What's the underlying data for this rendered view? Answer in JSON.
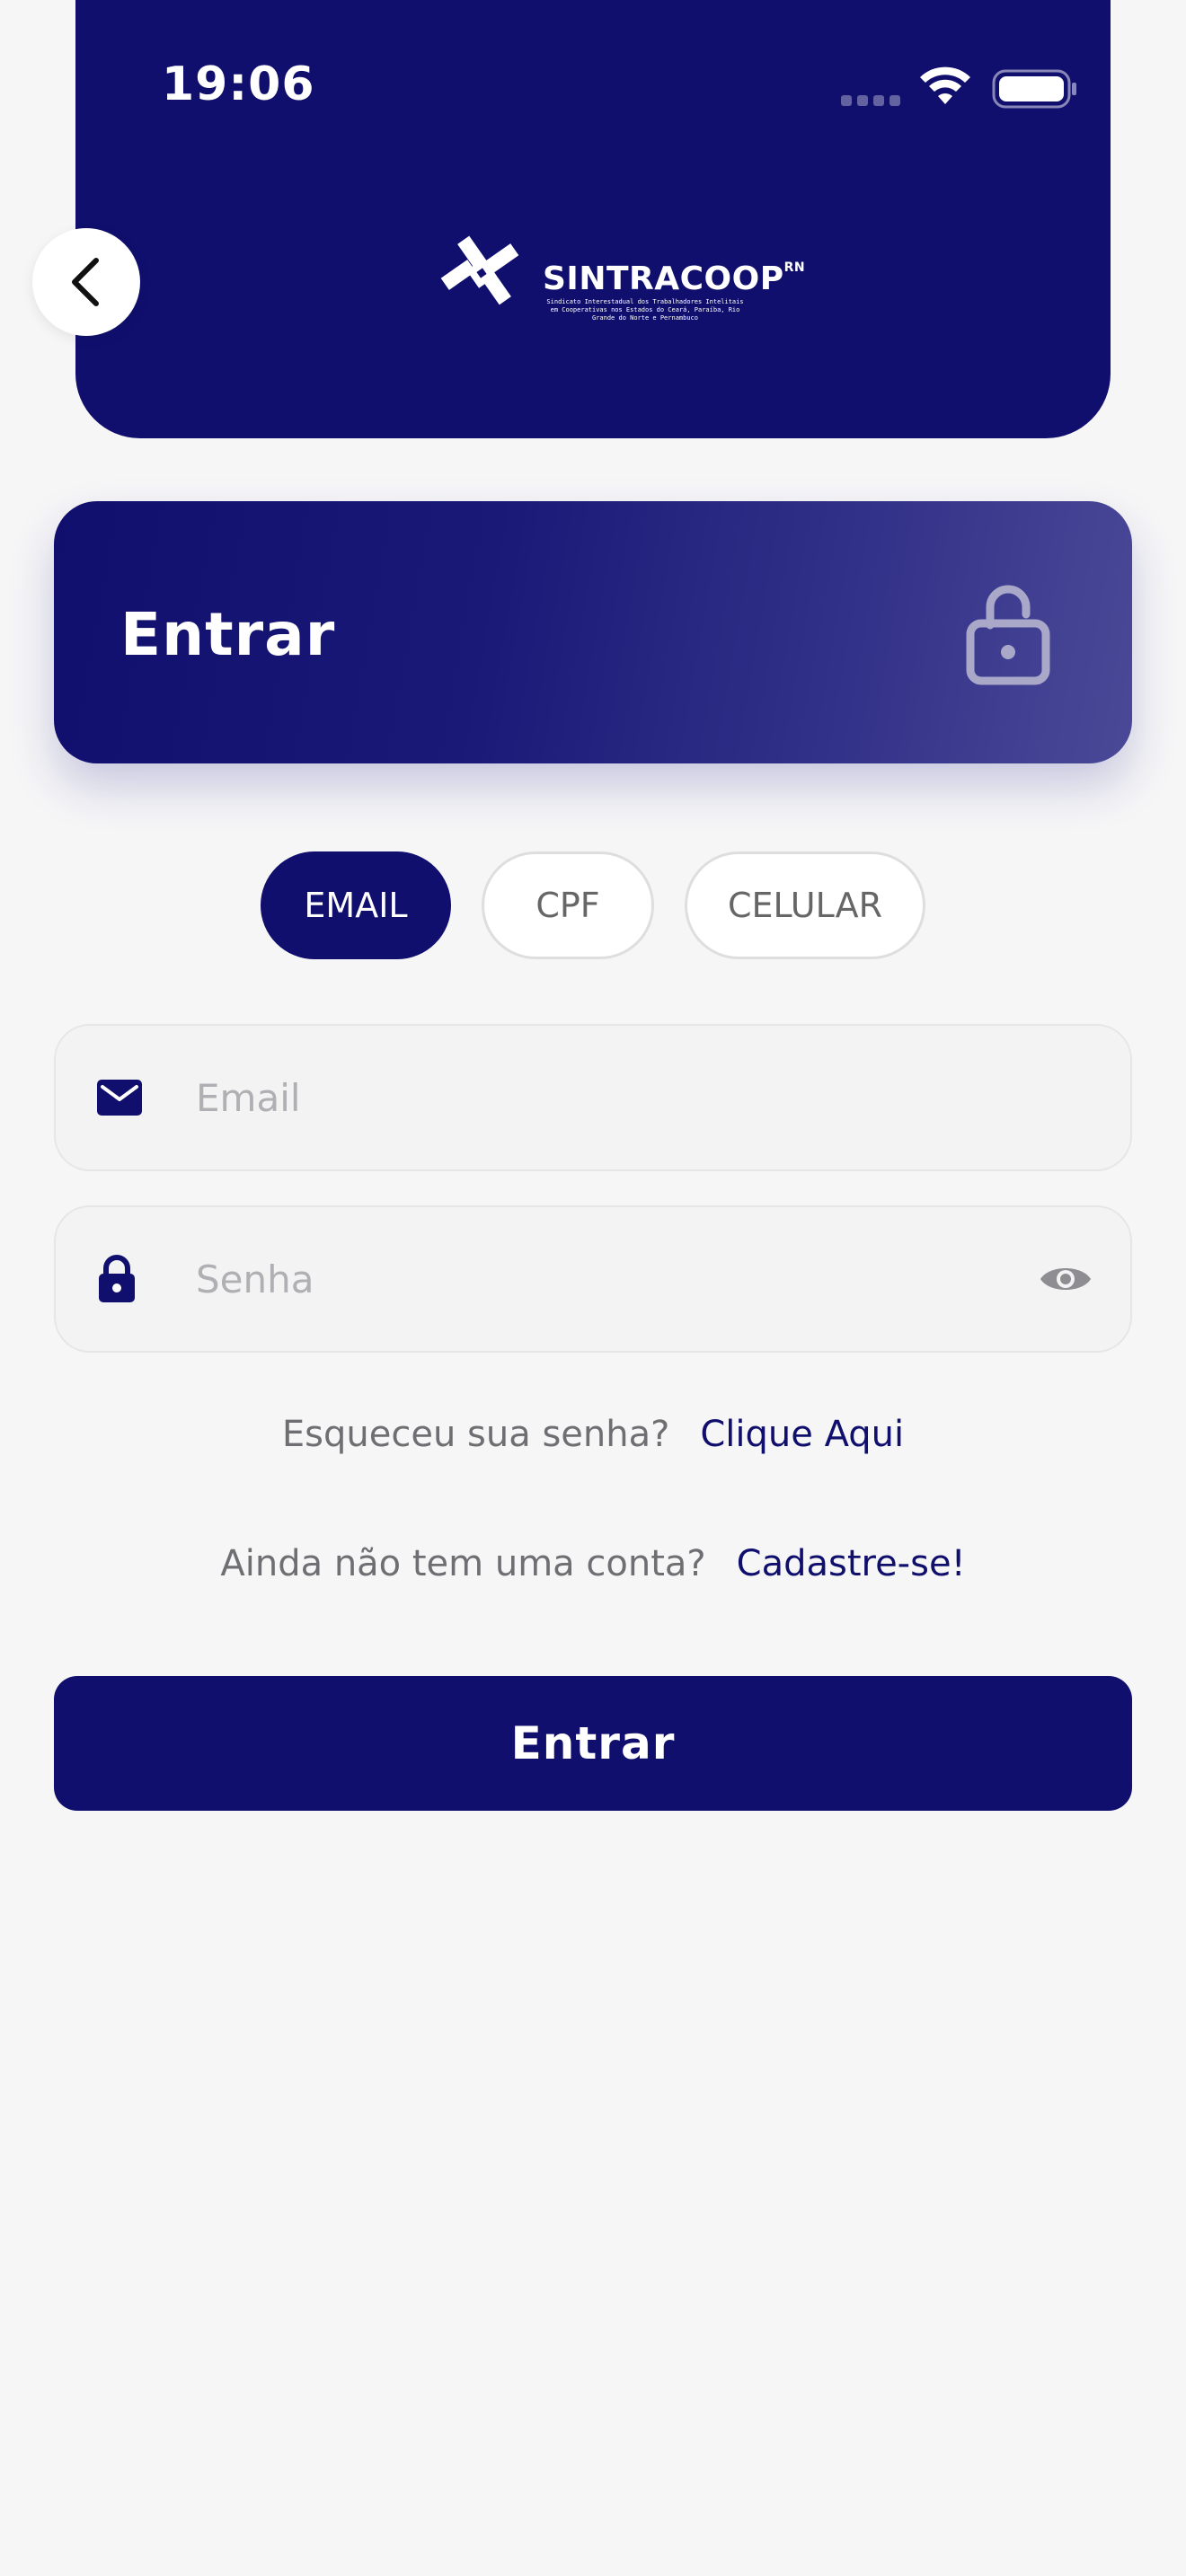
{
  "status_bar": {
    "time": "19:06",
    "wifi_icon": "wifi-icon",
    "battery_icon": "battery-icon"
  },
  "header": {
    "logo": {
      "name": "SINTRACOOP",
      "superscript": "RN",
      "subtitle": "Sindicato Interestadual dos Trabalhadores Intelitais em Cooperativas nos Estados do Ceará, Paraíba, Rio Grande do Norte e Pernambuco"
    },
    "back_icon": "chevron-left-icon"
  },
  "login_card": {
    "title": "Entrar",
    "icon": "unlock-icon"
  },
  "tabs": [
    {
      "label": "EMAIL",
      "active": true
    },
    {
      "label": "CPF",
      "active": false
    },
    {
      "label": "CELULAR",
      "active": false
    }
  ],
  "form": {
    "email_placeholder": "Email",
    "email_value": "",
    "password_placeholder": "Senha",
    "password_value": ""
  },
  "links": {
    "forgot_text": "Esqueceu sua senha?",
    "forgot_link": "Clique Aqui",
    "register_text": "Ainda não tem uma conta?",
    "register_link": "Cadastre-se!"
  },
  "submit_label": "Entrar",
  "colors": {
    "primary": "#100f6e",
    "background": "#f6f6f7",
    "muted_text": "#6f6f73"
  }
}
